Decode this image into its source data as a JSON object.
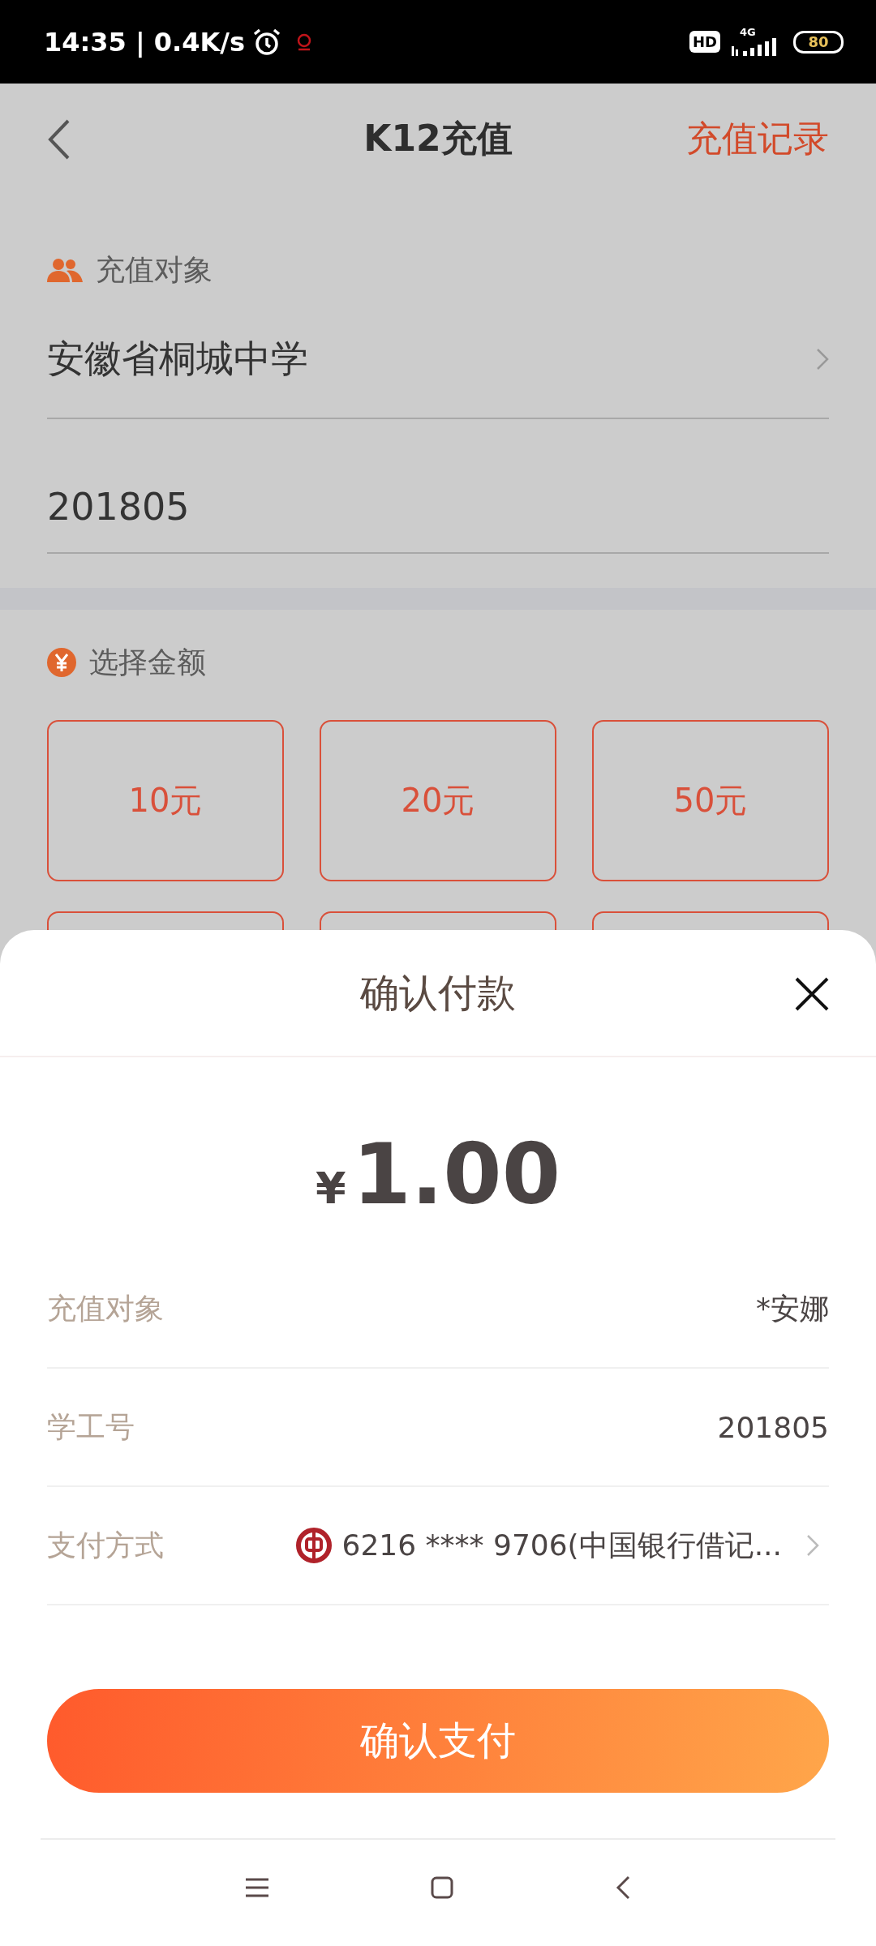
{
  "status_bar": {
    "time": "14:35 | 0.4K/s",
    "hd_badge": "HD",
    "network": "4G",
    "battery": "80"
  },
  "header": {
    "title": "K12充值",
    "action": "充值记录"
  },
  "target_section": {
    "label": "充值对象",
    "school": "安徽省桐城中学",
    "student_id": "201805"
  },
  "amount_section": {
    "label": "选择金额",
    "options": [
      {
        "label": "10元"
      },
      {
        "label": "20元"
      },
      {
        "label": "50元"
      }
    ]
  },
  "payment_sheet": {
    "title": "确认付款",
    "currency": "¥",
    "amount": "1.00",
    "rows": [
      {
        "kind": "text",
        "label": "充值对象",
        "value": "*安娜"
      },
      {
        "kind": "text",
        "label": "学工号",
        "value": "201805"
      },
      {
        "kind": "payment",
        "label": "支付方式",
        "value": "6216 **** 9706(中国银行借记..."
      }
    ],
    "confirm_button": "确认支付"
  }
}
